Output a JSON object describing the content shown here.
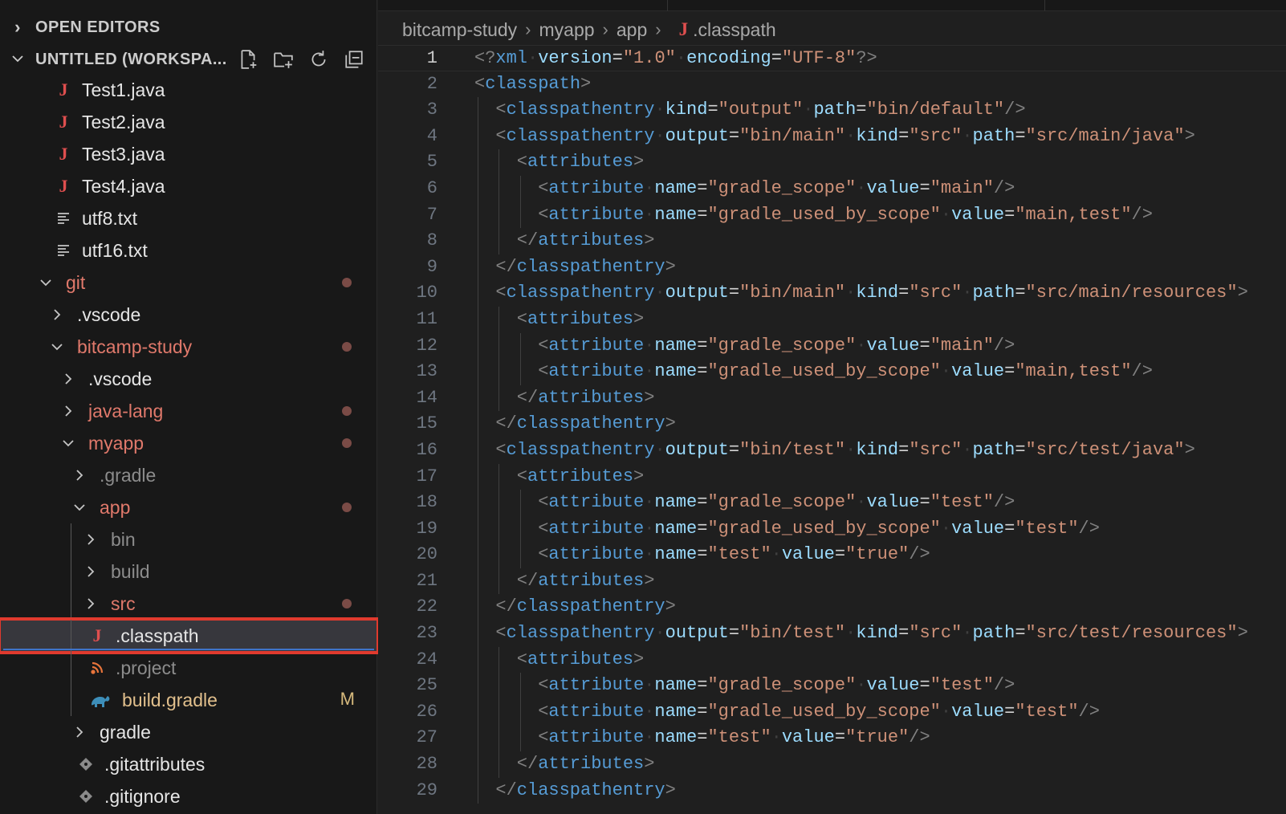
{
  "sidebar": {
    "open_editors": "OPEN EDITORS",
    "workspace": "UNTITLED (WORKSPA...",
    "actions": [
      "new-file-icon",
      "new-folder-icon",
      "refresh-icon",
      "collapse-all-icon"
    ],
    "tree": [
      {
        "label": "Test1.java",
        "depth": 3,
        "kind": "java",
        "color": "default"
      },
      {
        "label": "Test2.java",
        "depth": 3,
        "kind": "java",
        "color": "default"
      },
      {
        "label": "Test3.java",
        "depth": 3,
        "kind": "java",
        "color": "default"
      },
      {
        "label": "Test4.java",
        "depth": 3,
        "kind": "java",
        "color": "default"
      },
      {
        "label": "utf8.txt",
        "depth": 3,
        "kind": "txt",
        "color": "default"
      },
      {
        "label": "utf16.txt",
        "depth": 3,
        "kind": "txt",
        "color": "default"
      },
      {
        "label": "git",
        "depth": 2,
        "kind": "folder-open",
        "color": "git",
        "dot": true
      },
      {
        "label": ".vscode",
        "depth": 3,
        "kind": "folder",
        "color": "default"
      },
      {
        "label": "bitcamp-study",
        "depth": 3,
        "kind": "folder-open",
        "color": "git",
        "dot": true
      },
      {
        "label": ".vscode",
        "depth": 4,
        "kind": "folder",
        "color": "default"
      },
      {
        "label": "java-lang",
        "depth": 4,
        "kind": "folder",
        "color": "git",
        "dot": true
      },
      {
        "label": "myapp",
        "depth": 4,
        "kind": "folder-open",
        "color": "git",
        "dot": true
      },
      {
        "label": ".gradle",
        "depth": 5,
        "kind": "folder",
        "color": "dim"
      },
      {
        "label": "app",
        "depth": 5,
        "kind": "folder-open",
        "color": "git",
        "dot": true
      },
      {
        "label": "bin",
        "depth": 6,
        "kind": "folder",
        "color": "dim"
      },
      {
        "label": "build",
        "depth": 6,
        "kind": "folder",
        "color": "dim"
      },
      {
        "label": "src",
        "depth": 6,
        "kind": "folder",
        "color": "git",
        "dot": true
      },
      {
        "label": ".classpath",
        "depth": 6,
        "kind": "java",
        "color": "default",
        "selected": true
      },
      {
        "label": ".project",
        "depth": 6,
        "kind": "rss",
        "color": "dim"
      },
      {
        "label": "build.gradle",
        "depth": 6,
        "kind": "gradle",
        "color": "mod",
        "badge": "M"
      },
      {
        "label": "gradle",
        "depth": 5,
        "kind": "folder",
        "color": "default"
      },
      {
        "label": ".gitattributes",
        "depth": 5,
        "kind": "git",
        "color": "default"
      },
      {
        "label": ".gitignore",
        "depth": 5,
        "kind": "git",
        "color": "default"
      }
    ]
  },
  "editor": {
    "breadcrumb": [
      "bitcamp-study",
      "myapp",
      "app",
      ".classpath"
    ],
    "active_line": 1,
    "lines": [
      [
        [
          "p",
          "<?"
        ],
        [
          "t",
          "xml"
        ],
        [
          "ws",
          "·"
        ],
        [
          "a",
          "version"
        ],
        [
          "o",
          "="
        ],
        [
          "s",
          "\"1.0\""
        ],
        [
          "ws",
          "·"
        ],
        [
          "a",
          "encoding"
        ],
        [
          "o",
          "="
        ],
        [
          "s",
          "\"UTF-8\""
        ],
        [
          "p",
          "?>"
        ]
      ],
      [
        [
          "p",
          "<"
        ],
        [
          "t",
          "classpath"
        ],
        [
          "p",
          ">"
        ]
      ],
      [
        [
          "p",
          "<"
        ],
        [
          "t",
          "classpathentry"
        ],
        [
          "ws",
          "·"
        ],
        [
          "a",
          "kind"
        ],
        [
          "o",
          "="
        ],
        [
          "s",
          "\"output\""
        ],
        [
          "ws",
          "·"
        ],
        [
          "a",
          "path"
        ],
        [
          "o",
          "="
        ],
        [
          "s",
          "\"bin/default\""
        ],
        [
          "p",
          "/>"
        ]
      ],
      [
        [
          "p",
          "<"
        ],
        [
          "t",
          "classpathentry"
        ],
        [
          "ws",
          "·"
        ],
        [
          "a",
          "output"
        ],
        [
          "o",
          "="
        ],
        [
          "s",
          "\"bin/main\""
        ],
        [
          "ws",
          "·"
        ],
        [
          "a",
          "kind"
        ],
        [
          "o",
          "="
        ],
        [
          "s",
          "\"src\""
        ],
        [
          "ws",
          "·"
        ],
        [
          "a",
          "path"
        ],
        [
          "o",
          "="
        ],
        [
          "s",
          "\"src/main/java\""
        ],
        [
          "p",
          ">"
        ]
      ],
      [
        [
          "p",
          "<"
        ],
        [
          "t",
          "attributes"
        ],
        [
          "p",
          ">"
        ]
      ],
      [
        [
          "p",
          "<"
        ],
        [
          "t",
          "attribute"
        ],
        [
          "ws",
          "·"
        ],
        [
          "a",
          "name"
        ],
        [
          "o",
          "="
        ],
        [
          "s",
          "\"gradle_scope\""
        ],
        [
          "ws",
          "·"
        ],
        [
          "a",
          "value"
        ],
        [
          "o",
          "="
        ],
        [
          "s",
          "\"main\""
        ],
        [
          "p",
          "/>"
        ]
      ],
      [
        [
          "p",
          "<"
        ],
        [
          "t",
          "attribute"
        ],
        [
          "ws",
          "·"
        ],
        [
          "a",
          "name"
        ],
        [
          "o",
          "="
        ],
        [
          "s",
          "\"gradle_used_by_scope\""
        ],
        [
          "ws",
          "·"
        ],
        [
          "a",
          "value"
        ],
        [
          "o",
          "="
        ],
        [
          "s",
          "\"main,test\""
        ],
        [
          "p",
          "/>"
        ]
      ],
      [
        [
          "p",
          "</"
        ],
        [
          "t",
          "attributes"
        ],
        [
          "p",
          ">"
        ]
      ],
      [
        [
          "p",
          "</"
        ],
        [
          "t",
          "classpathentry"
        ],
        [
          "p",
          ">"
        ]
      ],
      [
        [
          "p",
          "<"
        ],
        [
          "t",
          "classpathentry"
        ],
        [
          "ws",
          "·"
        ],
        [
          "a",
          "output"
        ],
        [
          "o",
          "="
        ],
        [
          "s",
          "\"bin/main\""
        ],
        [
          "ws",
          "·"
        ],
        [
          "a",
          "kind"
        ],
        [
          "o",
          "="
        ],
        [
          "s",
          "\"src\""
        ],
        [
          "ws",
          "·"
        ],
        [
          "a",
          "path"
        ],
        [
          "o",
          "="
        ],
        [
          "s",
          "\"src/main/resources\""
        ],
        [
          "p",
          ">"
        ]
      ],
      [
        [
          "p",
          "<"
        ],
        [
          "t",
          "attributes"
        ],
        [
          "p",
          ">"
        ]
      ],
      [
        [
          "p",
          "<"
        ],
        [
          "t",
          "attribute"
        ],
        [
          "ws",
          "·"
        ],
        [
          "a",
          "name"
        ],
        [
          "o",
          "="
        ],
        [
          "s",
          "\"gradle_scope\""
        ],
        [
          "ws",
          "·"
        ],
        [
          "a",
          "value"
        ],
        [
          "o",
          "="
        ],
        [
          "s",
          "\"main\""
        ],
        [
          "p",
          "/>"
        ]
      ],
      [
        [
          "p",
          "<"
        ],
        [
          "t",
          "attribute"
        ],
        [
          "ws",
          "·"
        ],
        [
          "a",
          "name"
        ],
        [
          "o",
          "="
        ],
        [
          "s",
          "\"gradle_used_by_scope\""
        ],
        [
          "ws",
          "·"
        ],
        [
          "a",
          "value"
        ],
        [
          "o",
          "="
        ],
        [
          "s",
          "\"main,test\""
        ],
        [
          "p",
          "/>"
        ]
      ],
      [
        [
          "p",
          "</"
        ],
        [
          "t",
          "attributes"
        ],
        [
          "p",
          ">"
        ]
      ],
      [
        [
          "p",
          "</"
        ],
        [
          "t",
          "classpathentry"
        ],
        [
          "p",
          ">"
        ]
      ],
      [
        [
          "p",
          "<"
        ],
        [
          "t",
          "classpathentry"
        ],
        [
          "ws",
          "·"
        ],
        [
          "a",
          "output"
        ],
        [
          "o",
          "="
        ],
        [
          "s",
          "\"bin/test\""
        ],
        [
          "ws",
          "·"
        ],
        [
          "a",
          "kind"
        ],
        [
          "o",
          "="
        ],
        [
          "s",
          "\"src\""
        ],
        [
          "ws",
          "·"
        ],
        [
          "a",
          "path"
        ],
        [
          "o",
          "="
        ],
        [
          "s",
          "\"src/test/java\""
        ],
        [
          "p",
          ">"
        ]
      ],
      [
        [
          "p",
          "<"
        ],
        [
          "t",
          "attributes"
        ],
        [
          "p",
          ">"
        ]
      ],
      [
        [
          "p",
          "<"
        ],
        [
          "t",
          "attribute"
        ],
        [
          "ws",
          "·"
        ],
        [
          "a",
          "name"
        ],
        [
          "o",
          "="
        ],
        [
          "s",
          "\"gradle_scope\""
        ],
        [
          "ws",
          "·"
        ],
        [
          "a",
          "value"
        ],
        [
          "o",
          "="
        ],
        [
          "s",
          "\"test\""
        ],
        [
          "p",
          "/>"
        ]
      ],
      [
        [
          "p",
          "<"
        ],
        [
          "t",
          "attribute"
        ],
        [
          "ws",
          "·"
        ],
        [
          "a",
          "name"
        ],
        [
          "o",
          "="
        ],
        [
          "s",
          "\"gradle_used_by_scope\""
        ],
        [
          "ws",
          "·"
        ],
        [
          "a",
          "value"
        ],
        [
          "o",
          "="
        ],
        [
          "s",
          "\"test\""
        ],
        [
          "p",
          "/>"
        ]
      ],
      [
        [
          "p",
          "<"
        ],
        [
          "t",
          "attribute"
        ],
        [
          "ws",
          "·"
        ],
        [
          "a",
          "name"
        ],
        [
          "o",
          "="
        ],
        [
          "s",
          "\"test\""
        ],
        [
          "ws",
          "·"
        ],
        [
          "a",
          "value"
        ],
        [
          "o",
          "="
        ],
        [
          "s",
          "\"true\""
        ],
        [
          "p",
          "/>"
        ]
      ],
      [
        [
          "p",
          "</"
        ],
        [
          "t",
          "attributes"
        ],
        [
          "p",
          ">"
        ]
      ],
      [
        [
          "p",
          "</"
        ],
        [
          "t",
          "classpathentry"
        ],
        [
          "p",
          ">"
        ]
      ],
      [
        [
          "p",
          "<"
        ],
        [
          "t",
          "classpathentry"
        ],
        [
          "ws",
          "·"
        ],
        [
          "a",
          "output"
        ],
        [
          "o",
          "="
        ],
        [
          "s",
          "\"bin/test\""
        ],
        [
          "ws",
          "·"
        ],
        [
          "a",
          "kind"
        ],
        [
          "o",
          "="
        ],
        [
          "s",
          "\"src\""
        ],
        [
          "ws",
          "·"
        ],
        [
          "a",
          "path"
        ],
        [
          "o",
          "="
        ],
        [
          "s",
          "\"src/test/resources\""
        ],
        [
          "p",
          ">"
        ]
      ],
      [
        [
          "p",
          "<"
        ],
        [
          "t",
          "attributes"
        ],
        [
          "p",
          ">"
        ]
      ],
      [
        [
          "p",
          "<"
        ],
        [
          "t",
          "attribute"
        ],
        [
          "ws",
          "·"
        ],
        [
          "a",
          "name"
        ],
        [
          "o",
          "="
        ],
        [
          "s",
          "\"gradle_scope\""
        ],
        [
          "ws",
          "·"
        ],
        [
          "a",
          "value"
        ],
        [
          "o",
          "="
        ],
        [
          "s",
          "\"test\""
        ],
        [
          "p",
          "/>"
        ]
      ],
      [
        [
          "p",
          "<"
        ],
        [
          "t",
          "attribute"
        ],
        [
          "ws",
          "·"
        ],
        [
          "a",
          "name"
        ],
        [
          "o",
          "="
        ],
        [
          "s",
          "\"gradle_used_by_scope\""
        ],
        [
          "ws",
          "·"
        ],
        [
          "a",
          "value"
        ],
        [
          "o",
          "="
        ],
        [
          "s",
          "\"test\""
        ],
        [
          "p",
          "/>"
        ]
      ],
      [
        [
          "p",
          "<"
        ],
        [
          "t",
          "attribute"
        ],
        [
          "ws",
          "·"
        ],
        [
          "a",
          "name"
        ],
        [
          "o",
          "="
        ],
        [
          "s",
          "\"test\""
        ],
        [
          "ws",
          "·"
        ],
        [
          "a",
          "value"
        ],
        [
          "o",
          "="
        ],
        [
          "s",
          "\"true\""
        ],
        [
          "p",
          "/>"
        ]
      ],
      [
        [
          "p",
          "</"
        ],
        [
          "t",
          "attributes"
        ],
        [
          "p",
          ">"
        ]
      ],
      [
        [
          "p",
          "</"
        ],
        [
          "t",
          "classpathentry"
        ],
        [
          "p",
          ">"
        ]
      ]
    ],
    "indents": [
      0,
      0,
      1,
      1,
      2,
      3,
      3,
      2,
      1,
      1,
      2,
      3,
      3,
      2,
      1,
      1,
      2,
      3,
      3,
      3,
      2,
      1,
      1,
      2,
      3,
      3,
      3,
      2,
      1
    ]
  }
}
